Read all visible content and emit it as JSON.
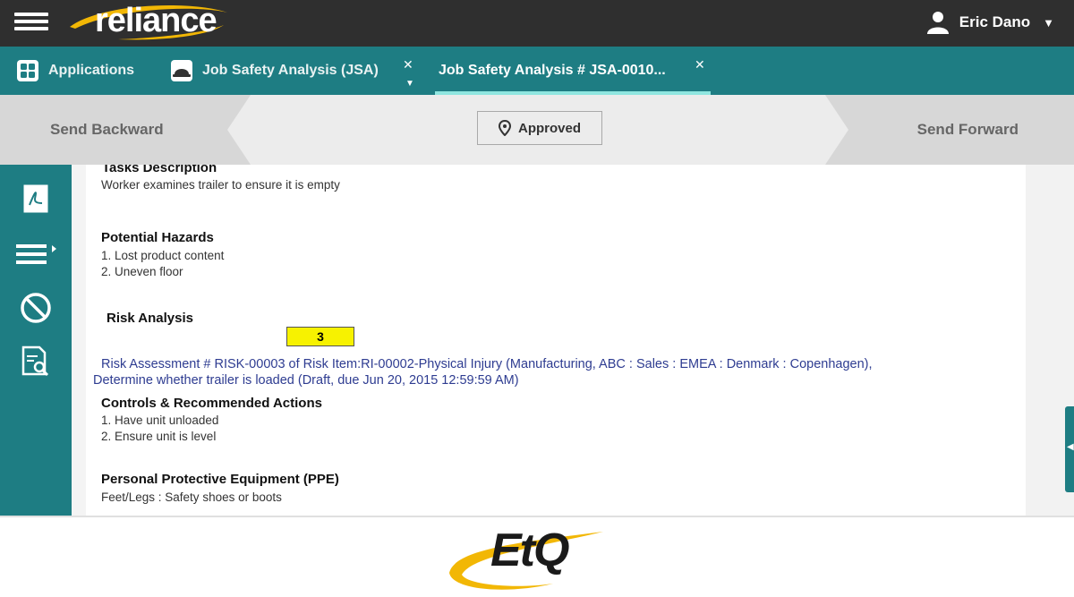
{
  "header": {
    "logo_text": "reliance",
    "user_name": "Eric Dano"
  },
  "tabs": [
    {
      "label": "Applications"
    },
    {
      "label": "Job Safety Analysis (JSA)"
    },
    {
      "label": "Job Safety Analysis # JSA-0010..."
    }
  ],
  "workflow": {
    "send_backward": "Send Backward",
    "status": "Approved",
    "send_forward": "Send Forward"
  },
  "sidebar": {
    "items": [
      "pdf-icon",
      "menu-list-icon",
      "cancel-icon",
      "document-search-icon"
    ]
  },
  "content": {
    "tasks_title": "Tasks Description",
    "tasks_text": "Worker examines trailer to ensure it is empty",
    "hazards_title": "Potential Hazards",
    "hazards": [
      "1. Lost product content",
      "2. Uneven floor"
    ],
    "risk_title": "Risk Analysis",
    "risk_value": "3",
    "risk_link_line1": "Risk Assessment # RISK-00003 of Risk Item:RI-00002-Physical Injury (Manufacturing, ABC : Sales : EMEA : Denmark : Copenhagen),",
    "risk_link_line2": "Determine whether trailer is loaded (Draft, due Jun 20, 2015 12:59:59 AM)",
    "controls_title": "Controls & Recommended Actions",
    "controls": [
      "1. Have unit unloaded",
      "2. Ensure unit is level"
    ],
    "ppe_title": "Personal Protective Equipment (PPE)",
    "ppe_text": "Feet/Legs : Safety shoes or boots"
  },
  "footer": {
    "logo_text": "EtQ"
  },
  "colors": {
    "topbar": "#2f2f2f",
    "teal": "#1e7d83",
    "workflow_bg": "#d7d7d7",
    "risk_yellow": "#f7f200",
    "link_blue": "#2e3c91",
    "logo_swoosh": "#f2b705"
  }
}
